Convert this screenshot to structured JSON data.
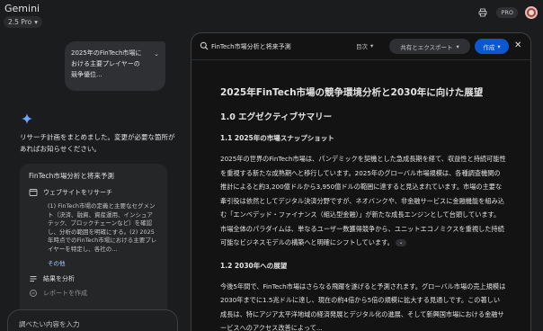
{
  "app": {
    "title": "Gemini",
    "model_label": "2.5 Pro"
  },
  "topbar": {
    "pro_badge": "PRO"
  },
  "conversation": {
    "user_message": "2025年のFinTech市場における主要プレイヤーの競争優位...",
    "reply_text": "リサーチ計画をまとめました。変更が必要な箇所があればお知らせください。",
    "plan": {
      "title": "FinTech市場分析と将来予測",
      "steps": [
        {
          "icon": "globe-window-icon",
          "label": "ウェブサイトをリサーチ"
        },
        {
          "icon": "list-icon",
          "label": "結果を分析"
        },
        {
          "icon": "document-icon",
          "label": "レポートを作成"
        }
      ],
      "step1_detail": "(1) FinTech市場の定義と主要なセグメント（決済、融資、資産運用、インシュアテック、ブロックチェーンなど）を確認し、分析の範囲を明確にする。(2) 2025年時点でのFinTech市場における主要プレイヤーを特定し、各社の...",
      "more_link": "その他"
    },
    "input_placeholder": "調べたい内容を入力"
  },
  "panel": {
    "title": "FinTech市場分析と将来予測",
    "toc_label": "目次",
    "share_label": "共有とエクスポート",
    "create_label": "作成",
    "doc": {
      "h1": "2025年FinTech市場の競争環境分析と2030年に向けた展望",
      "h2": "1.0 エグゼクティブサマリー",
      "sections": [
        {
          "heading": "1.1 2025年の市場スナップショット",
          "body": "2025年の世界のFinTech市場は、パンデミックを契機とした急成長期を経て、収益性と持続可能性を重視する新たな成熟期へと移行しています。2025年のグローバル市場規模は、各種調査機関の推計によると約3,200億ドルから3,950億ドルの範囲に達すると見込まれています。市場の主要な牽引役は依然としてデジタル決済分野ですが、ネオバンクや、非金融サービスに金融機能を組み込む「エンベデッド・ファイナンス（組込型金融）」が新たな成長エンジンとして台頭しています。市場全体のパラダイムは、単なるユーザー数獲得競争から、ユニットエコノミクスを重視した持続可能なビジネスモデルの構築へと明確にシフトしています。"
        },
        {
          "heading": "1.2 2030年への展望",
          "body": "今後5年間で、FinTech市場はさらなる飛躍を遂げると予測されます。グローバル市場の売上規模は2030年までに1.5兆ドルに達し、現在の約4倍から5倍の規模に拡大する見通しです。この著しい成長は、特にアジア太平洋地域の経済発展とデジタル化の進展、そして新興国市場における金融サービスへのアクセス改善によって..."
        }
      ],
      "cite_chip": "⌄"
    }
  }
}
